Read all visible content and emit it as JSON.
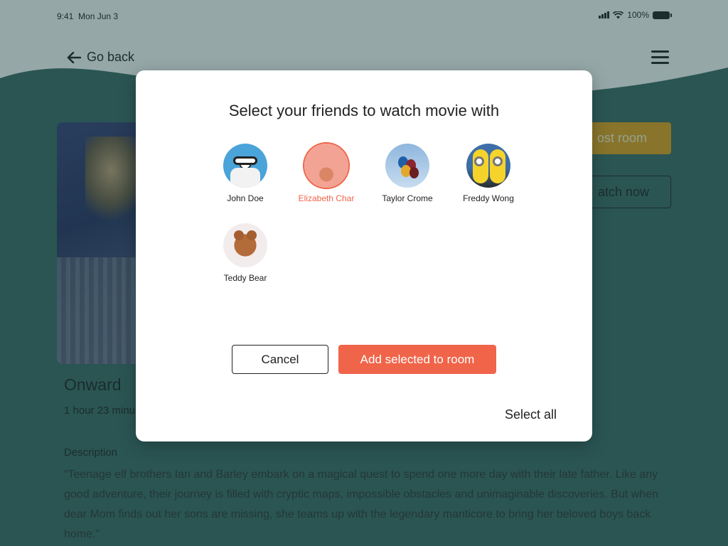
{
  "status_bar": {
    "time": "9:41",
    "date": "Mon Jun 3",
    "battery": "100%"
  },
  "nav": {
    "back_label": "Go back"
  },
  "movie": {
    "title": "Onward",
    "duration": "1 hour 23 minu",
    "description_label": "Description",
    "description": "“Teenage elf brothers Ian and Barley embark on a magical quest to spend one more day with their late father. Like any good adventure, their journey is filled with cryptic maps, impossible obstacles and unimaginable discoveries. But when dear Mom finds out her sons are missing, she teams up with the legendary manticore to bring her beloved boys back home.”",
    "host_room_label": "ost room",
    "watch_now_label": "atch now"
  },
  "modal": {
    "title": "Select your friends to watch movie with",
    "friends": [
      {
        "name": "John Doe",
        "selected": false,
        "avatar_icon": "dexter-avatar-icon"
      },
      {
        "name": "Elizabeth Char",
        "selected": true,
        "avatar_icon": "room-avatar-icon"
      },
      {
        "name": "Taylor Crome",
        "selected": false,
        "avatar_icon": "balloons-avatar-icon"
      },
      {
        "name": "Freddy Wong",
        "selected": false,
        "avatar_icon": "minions-avatar-icon"
      },
      {
        "name": "Teddy Bear",
        "selected": false,
        "avatar_icon": "teddy-bear-avatar-icon"
      }
    ],
    "cancel_label": "Cancel",
    "add_label": "Add selected to room",
    "select_all_label": "Select all"
  },
  "colors": {
    "accent": "#f0644a",
    "host_button": "#e7a21d",
    "background_wave": "#3c6a66",
    "overlay": "rgba(20, 60, 60, 0.45)"
  }
}
